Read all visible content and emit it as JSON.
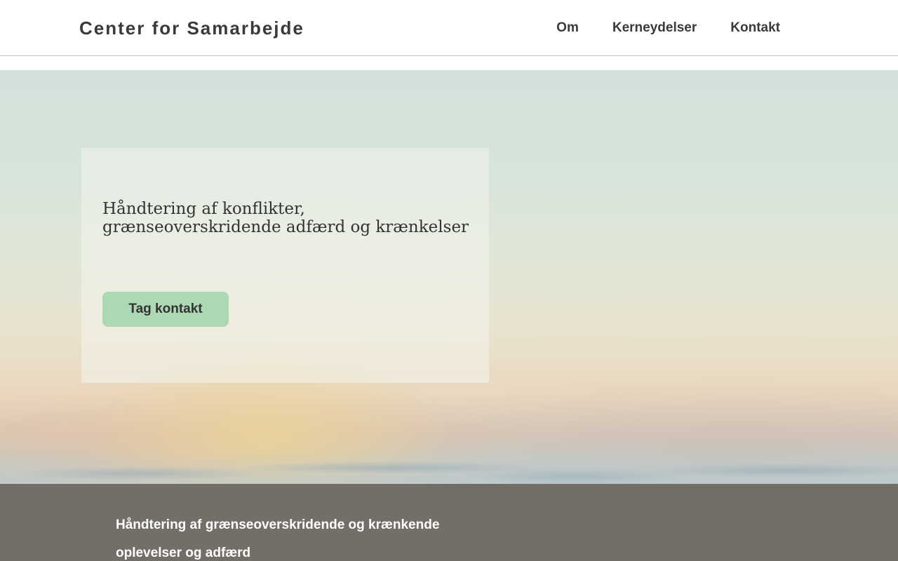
{
  "header": {
    "site_title": "Center for Samarbejde",
    "nav": [
      {
        "label": "Om"
      },
      {
        "label": "Kerneydelser"
      },
      {
        "label": "Kontakt"
      }
    ]
  },
  "hero": {
    "heading": "Håndtering af konflikter, grænseoverskridende adfærd og krænkelser",
    "cta_label": "Tag kontakt"
  },
  "intro": {
    "text": "Håndtering af grænseoverskridende og krænkende oplevelser og adfærd"
  },
  "colors": {
    "cta_background": "#acd8b4",
    "intro_background": "#736e68",
    "text_dark": "#3a3a3a"
  }
}
